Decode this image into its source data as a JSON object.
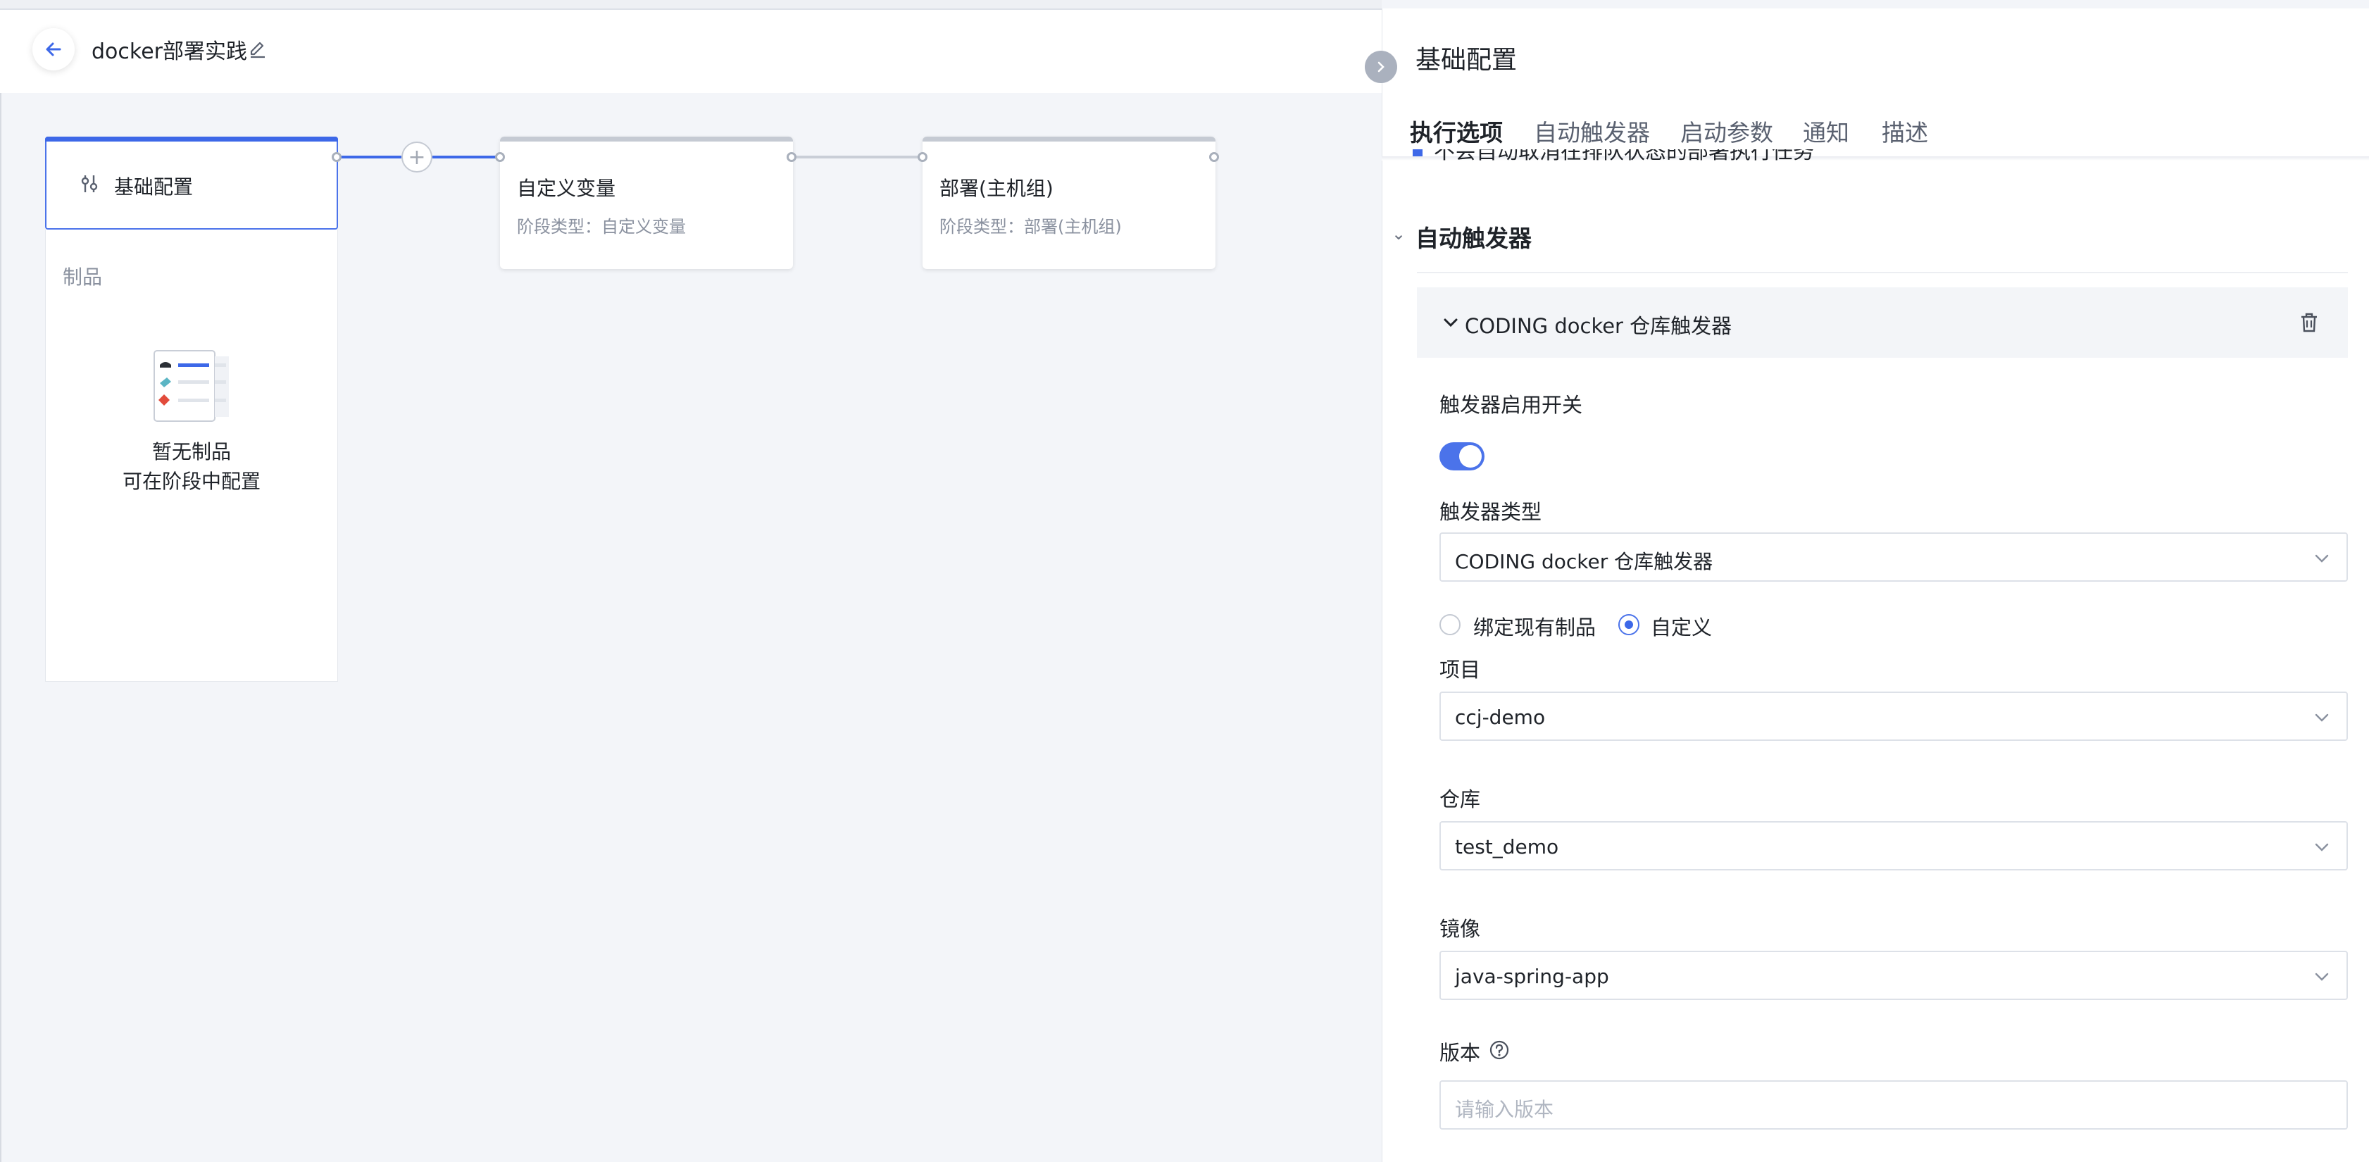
{
  "header": {
    "title": "docker部署实践"
  },
  "pipeline": {
    "stages": [
      {
        "name": "基础配置"
      },
      {
        "name": "自定义变量",
        "subtitle": "阶段类型：自定义变量"
      },
      {
        "name": "部署(主机组)",
        "subtitle": "阶段类型：部署(主机组)"
      }
    ],
    "artifacts_label": "制品",
    "empty_title": "暂无制品",
    "empty_hint": "可在阶段中配置"
  },
  "panel": {
    "title": "基础配置",
    "tabs": [
      {
        "label": "执行选项",
        "active": true
      },
      {
        "label": "自动触发器"
      },
      {
        "label": "启动参数"
      },
      {
        "label": "通知"
      },
      {
        "label": "描述"
      }
    ],
    "cutoff_text": "不会自动取消在排队状态的部署执行任务",
    "section_title": "自动触发器",
    "trigger": {
      "header": "CODING docker 仓库触发器",
      "enable_label": "触发器启用开关",
      "enabled": true,
      "type_label": "触发器类型",
      "type_value": "CODING docker 仓库触发器",
      "radio_options": [
        "绑定现有制品",
        "自定义"
      ],
      "radio_selected": "自定义",
      "project_label": "项目",
      "project_value": "ccj-demo",
      "repo_label": "仓库",
      "repo_value": "test_demo",
      "image_label": "镜像",
      "image_value": "java-spring-app",
      "version_label": "版本",
      "version_placeholder": "请输入版本"
    }
  },
  "colors": {
    "accent": "#3d68e8",
    "toggle": "#4b73ea",
    "canvas_bg": "#f3f5f9"
  }
}
